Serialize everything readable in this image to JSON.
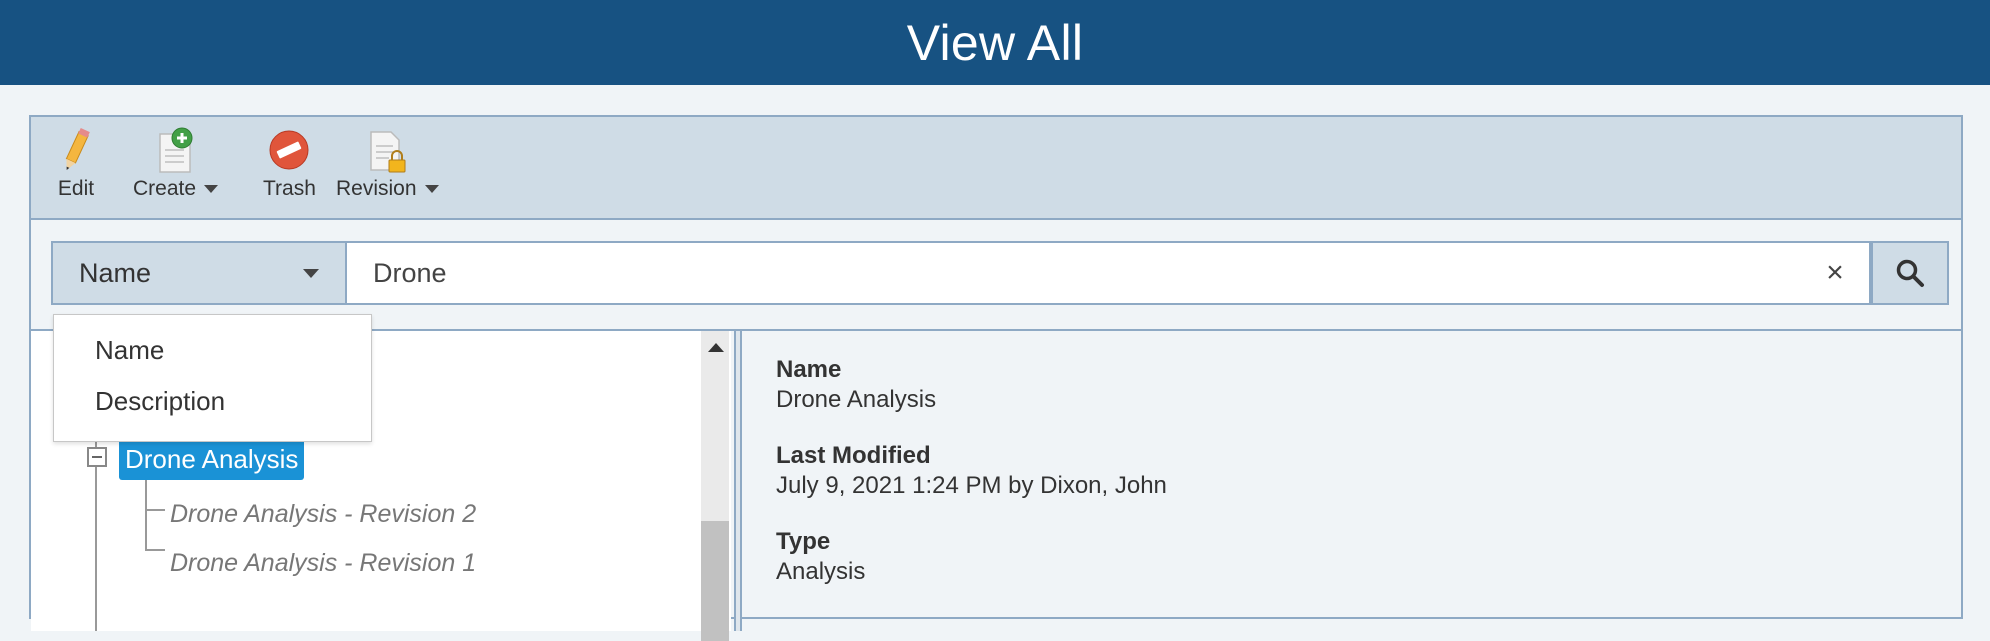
{
  "header": {
    "title": "View All"
  },
  "toolbar": {
    "edit_label": "Edit",
    "create_label": "Create",
    "trash_label": "Trash",
    "revision_label": "Revision"
  },
  "search": {
    "field_selected": "Name",
    "query": "Drone",
    "field_options": [
      "Name",
      "Description"
    ]
  },
  "tree": {
    "selected_node": "Drone Analysis",
    "children": [
      "Drone Analysis - Revision 2",
      "Drone Analysis - Revision 1"
    ]
  },
  "details": {
    "name_label": "Name",
    "name_value": "Drone Analysis",
    "modified_label": "Last Modified",
    "modified_value": "July 9, 2021 1:24 PM by Dixon, John",
    "type_label": "Type",
    "type_value": "Analysis"
  },
  "colors": {
    "header_bg": "#175282",
    "toolbar_bg": "#cfdce6",
    "selected_node_bg": "#1a92d6",
    "border": "#8ea9c4"
  },
  "icons": [
    "pencil-icon",
    "create-document-icon",
    "trash-icon",
    "revision-lock-icon",
    "clear-icon",
    "search-icon",
    "chevron-down-icon",
    "collapse-icon"
  ]
}
